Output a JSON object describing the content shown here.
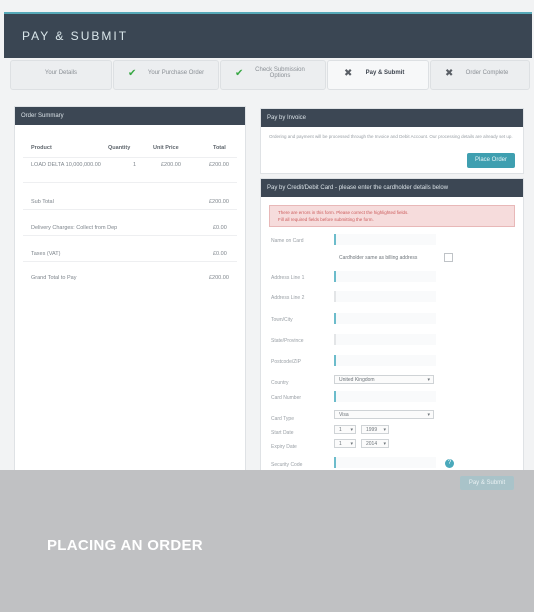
{
  "header": {
    "title": "PAY & SUBMIT"
  },
  "steps": [
    {
      "label": "Your Details",
      "state": "plain"
    },
    {
      "label": "Your Purchase Order",
      "state": "done"
    },
    {
      "label": "Check Submission Options",
      "state": "done"
    },
    {
      "label": "Pay & Submit",
      "state": "current"
    },
    {
      "label": "Order Complete",
      "state": "pending"
    }
  ],
  "order_summary": {
    "title": "Order Summary",
    "columns": [
      "Product",
      "Quantity",
      "Unit Price",
      "Total"
    ],
    "item": {
      "product": "LOAD DELTA 10,000,000.00",
      "quantity": "1",
      "unit_price": "£200.00",
      "total": "£200.00"
    },
    "rows": [
      {
        "label": "Sub Total",
        "value": "£200.00"
      },
      {
        "label": "Delivery Charges: Collect from Dep",
        "value": "£0.00"
      },
      {
        "label": "Taxes (VAT)",
        "value": "£0.00"
      },
      {
        "label": "Grand Total to Pay",
        "value": "£200.00"
      }
    ]
  },
  "pay_invoice": {
    "title": "Pay by Invoice",
    "note": "Ordering and payment will be processed through the Invoice and Debit Account. Our processing details are already set up.",
    "button": "Place Order"
  },
  "pay_card": {
    "title": "Pay by Credit/Debit Card - please enter the cardholder details below",
    "alert_line1": "There are errors in this form. Please correct the highlighted fields.",
    "alert_line2": "Fill all required fields before submitting the form.",
    "fields": {
      "name": "Name on Card",
      "use_address": "Cardholder same as billing address",
      "address1": "Address Line 1",
      "address2": "Address Line 2",
      "town": "Town/City",
      "county": "State/Province",
      "postcode": "Postcode/ZIP",
      "country": "Country",
      "country_value": "United Kingdom",
      "card_number": "Card Number",
      "card_type": "Card Type",
      "card_type_value": "Visa",
      "start_date": "Start Date",
      "expiry_date": "Expiry Date",
      "security": "Security Code",
      "start_month": "1",
      "start_year": "1999",
      "exp_month": "1",
      "exp_year": "2014"
    },
    "submit": "Pay & Submit"
  },
  "caption": {
    "text": "PLACING AN ORDER"
  }
}
